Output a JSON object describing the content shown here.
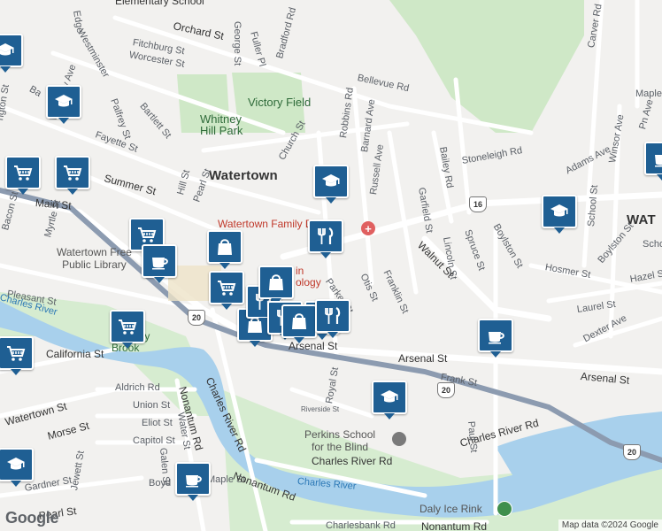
{
  "map": {
    "colors": {
      "background": "#f2f1ef",
      "road": "#ffffff",
      "highway": "#8c9bb0",
      "water": "#a8d0ec",
      "park": "#cfe8c7",
      "pin": "#1f5f93"
    }
  },
  "places": {
    "town_main": "Watertown",
    "town_east": "WAT",
    "victory_field": "Victory Field",
    "whitney_hill": "Whitney\nHill Park",
    "hospital": "Watertown Family Dental",
    "library": "Watertown Free\nPublic Library",
    "perkins": "Perkins School\nfor the Blind",
    "daly": "Daly Ice Rink",
    "elementary": "Elementary School",
    "river_north": "Charles River",
    "river_south": "Charles River",
    "brook": "Laundry\nBrook",
    "dentistry_frag": "in\nology"
  },
  "streets": {
    "orchard": "Orchard St",
    "fitchburg": "Fitchburg St",
    "worcester": "Worcester St",
    "westminster": "Westminster",
    "bellevue": "Bellevue Rd",
    "waverley": "Waverley Ave",
    "palfrey": "Palfrey St",
    "bartlett": "Bartlett St",
    "fayette": "Fayette St",
    "summer": "Summer St",
    "main": "Main St",
    "myrtle": "Myrtle St",
    "bacon": "Bacon St",
    "pleasant": "Pleasant St",
    "california": "California St",
    "watertown_st": "Watertown St",
    "morse": "Morse St",
    "gardner": "Gardner St",
    "jewett": "Jewett St",
    "pearl_s": "Pearl St",
    "boyd": "Boyd",
    "maple": "Maple St",
    "church": "Church St",
    "hill": "Hill St",
    "pearl_n": "Pearl St",
    "george": "George St",
    "fuller": "Fuller Pl",
    "bradford": "Bradford Rd",
    "robbins": "Robbins Rd",
    "barnard": "Barnard Ave",
    "russell": "Russell Ave",
    "garfield": "Garfield St",
    "bailey": "Bailey Rd",
    "stoneleigh": "Stoneleigh Rd",
    "adams": "Adams Ave",
    "carver": "Carver Rd",
    "winsor": "Winsor Ave",
    "school": "School St",
    "spruce": "Spruce St",
    "lincoln": "Lincoln St",
    "boylston": "Boylston St",
    "boylston_e": "Boylston St",
    "walnut": "Walnut St",
    "otis": "Otis St",
    "franklin": "Franklin St",
    "parker": "Parker St",
    "hosmer": "Hosmer St",
    "hazel": "Hazel St",
    "laurel": "Laurel St",
    "dexter": "Dexter Ave",
    "arsenal": "Arsenal St",
    "arsenal_w": "Arsenal St",
    "arsenal_e": "Arsenal St",
    "frank": "Frank St",
    "aldrich": "Aldrich Rd",
    "union": "Union St",
    "eliot": "Eliot St",
    "capitol": "Capitol St",
    "water": "Water St",
    "galen": "Galen St",
    "nonantum_n": "Nonantum Rd",
    "nonantum_s": "Nonantum Rd",
    "nonantum_se": "Nonantum Rd",
    "charles_river_rd_w": "Charles River Rd",
    "charles_river_rd_c": "Charles River Rd",
    "charles_river_rd_e": "Charles River Rd",
    "royal": "Royal St",
    "riverside": "Riverside St",
    "paul": "Paul St",
    "charlesbank": "Charlesbank Rd",
    "maple_ne": "Maple",
    "lexington": "ngton St",
    "edge": "Edge",
    "carroll": "Ba",
    "pn_ave": "Pn Ave",
    "school_e": "School",
    "waverley_n": "Ge"
  },
  "routes": {
    "r16": "16",
    "r20_west": "20",
    "r20_mid": "20",
    "r20_east": "20"
  },
  "pins": [
    {
      "kind": "school-icon",
      "count": ""
    },
    {
      "kind": "school-icon",
      "count": ""
    },
    {
      "kind": "school-icon",
      "count": ""
    },
    {
      "kind": "school-icon",
      "count": ""
    },
    {
      "kind": "grocery-icon",
      "count": ""
    },
    {
      "kind": "grocery-icon",
      "count": ""
    },
    {
      "kind": "grocery-icon",
      "count": ""
    },
    {
      "kind": "grocery-icon",
      "count": ""
    },
    {
      "kind": "grocery-icon",
      "count": ""
    },
    {
      "kind": "coffee-icon",
      "count": ""
    },
    {
      "kind": "coffee-icon",
      "count": ""
    },
    {
      "kind": "coffee-icon",
      "count": ""
    },
    {
      "kind": "restaurant-icon",
      "count": ""
    },
    {
      "kind": "shopping-icon",
      "count": ""
    },
    {
      "kind": "restaurant-icon",
      "count": ""
    },
    {
      "kind": "shopping-icon",
      "count": ""
    },
    {
      "kind": "school-icon",
      "count": ""
    },
    {
      "kind": "grocery-icon",
      "count": ""
    },
    {
      "kind": "school-icon",
      "count": ""
    },
    {
      "kind": "coffee-icon",
      "count": ""
    }
  ],
  "footer": {
    "logo": "Google",
    "attribution": "Map data ©2024 Google"
  }
}
